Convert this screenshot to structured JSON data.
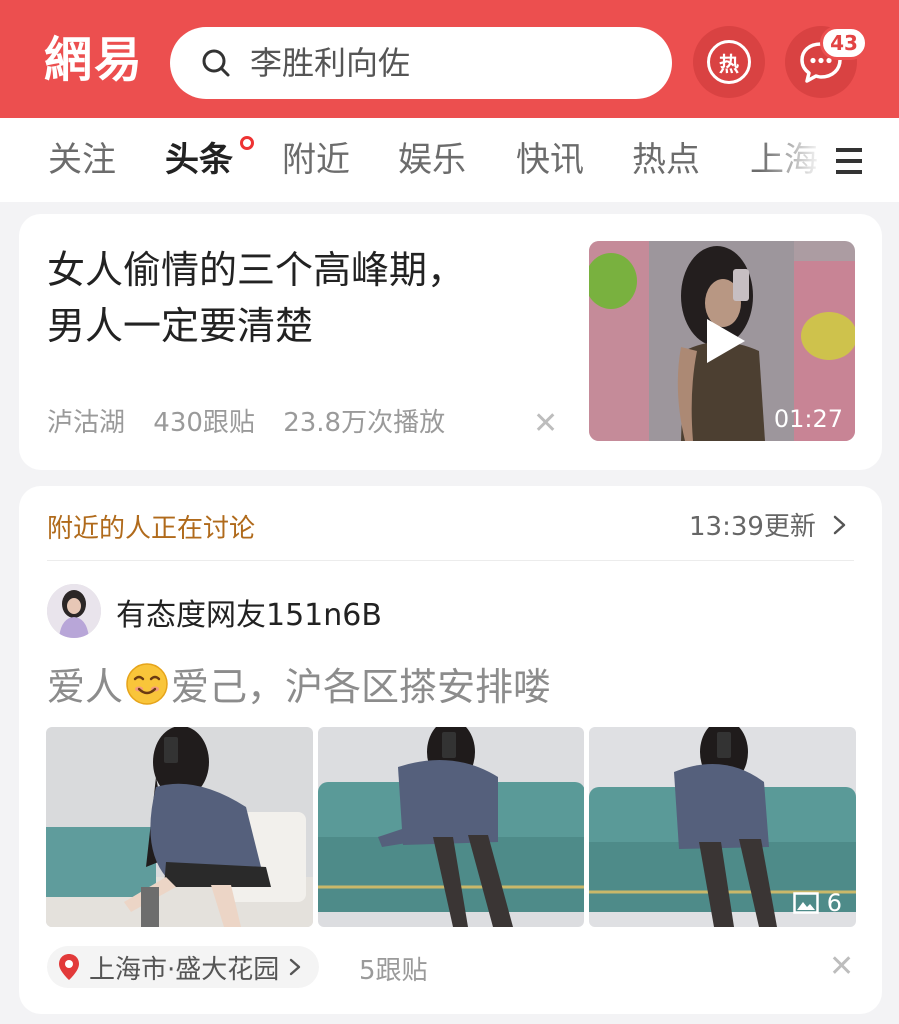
{
  "header": {
    "logo": "網易",
    "search_placeholder": "李胜利向佐",
    "hot_label": "热",
    "message_badge": "43"
  },
  "tabs": [
    {
      "label": "关注",
      "active": false
    },
    {
      "label": "头条",
      "active": true,
      "dot": true
    },
    {
      "label": "附近",
      "active": false
    },
    {
      "label": "娱乐",
      "active": false
    },
    {
      "label": "快讯",
      "active": false
    },
    {
      "label": "热点",
      "active": false
    },
    {
      "label": "上海",
      "active": false
    }
  ],
  "article": {
    "title_line1": "女人偷情的三个高峰期，",
    "title_line2": "男人一定要清楚",
    "source": "泸沽湖",
    "comments": "430跟贴",
    "plays": "23.8万次播放",
    "video_duration": "01:27"
  },
  "nearby": {
    "section_title": "附近的人正在讨论",
    "update_time": "13:39更新",
    "username": "有态度网友151n6B",
    "post_before_emoji": "爱人",
    "post_after_emoji": "爱己，沪各区搽安排喽",
    "photo_count": "6",
    "location": "上海市·盛大花园",
    "replies": "5跟贴"
  },
  "colors": {
    "brand_red": "#ec4f4f",
    "section_title": "#b06a1b"
  }
}
